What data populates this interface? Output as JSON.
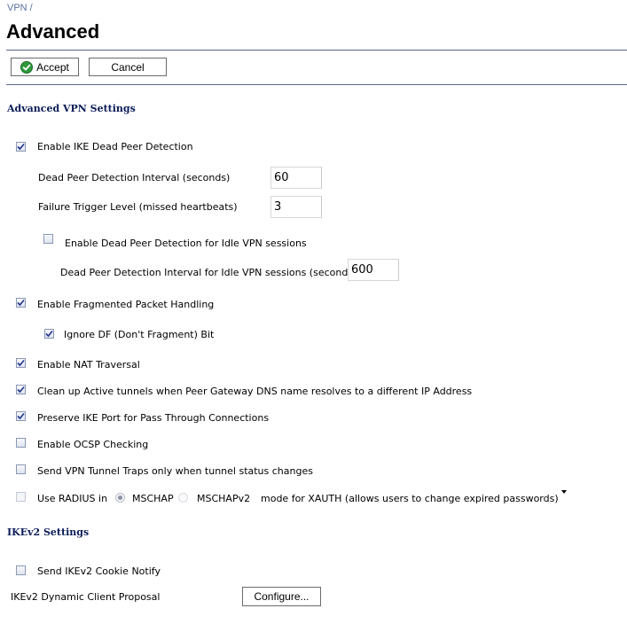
{
  "breadcrumb": "VPN /",
  "page_title": "Advanced",
  "toolbar": {
    "accept_label": "Accept",
    "cancel_label": "Cancel"
  },
  "colors": {
    "section_title": "#0b1c58",
    "rule": "#5d6691",
    "accept_icon": "#2f9a3c"
  },
  "sections": {
    "advanced_vpn": "Advanced VPN Settings",
    "ikev2": "IKEv2 Settings"
  },
  "settings": {
    "ike_dpd": {
      "label": "Enable IKE Dead Peer Detection",
      "checked": true
    },
    "dpd_interval": {
      "label": "Dead Peer Detection Interval (seconds)",
      "value": "60"
    },
    "failure_trigger": {
      "label": "Failure Trigger Level (missed heartbeats)",
      "value": "3"
    },
    "dpd_idle": {
      "label": "Enable Dead Peer Detection for Idle VPN sessions",
      "checked": false
    },
    "dpd_idle_interval": {
      "label": "Dead Peer Detection Interval for Idle VPN sessions (seconds)",
      "value": "600"
    },
    "fragmented": {
      "label": "Enable Fragmented Packet Handling",
      "checked": true
    },
    "ignore_df": {
      "label": "Ignore DF (Don't Fragment) Bit",
      "checked": true
    },
    "nat_traversal": {
      "label": "Enable NAT Traversal",
      "checked": true
    },
    "cleanup_tunnels": {
      "label": "Clean up Active tunnels when Peer Gateway DNS name resolves to a different IP Address",
      "checked": true
    },
    "preserve_ike": {
      "label": "Preserve IKE Port for Pass Through Connections",
      "checked": true
    },
    "ocsp": {
      "label": "Enable OCSP Checking",
      "checked": false
    },
    "tunnel_traps": {
      "label": "Send VPN Tunnel Traps only when tunnel status changes",
      "checked": false
    },
    "radius": {
      "label_prefix": "Use RADIUS in",
      "option_mschap": "MSCHAP",
      "option_mschapv2": "MSCHAPv2",
      "label_suffix": "mode for XAUTH (allows users to change expired passwords)",
      "checked": false,
      "selected": "MSCHAP"
    },
    "ikev2_cookie": {
      "label": "Send IKEv2 Cookie Notify",
      "checked": false
    },
    "ikev2_proposal": {
      "label": "IKEv2 Dynamic Client Proposal",
      "button_label": "Configure..."
    }
  }
}
